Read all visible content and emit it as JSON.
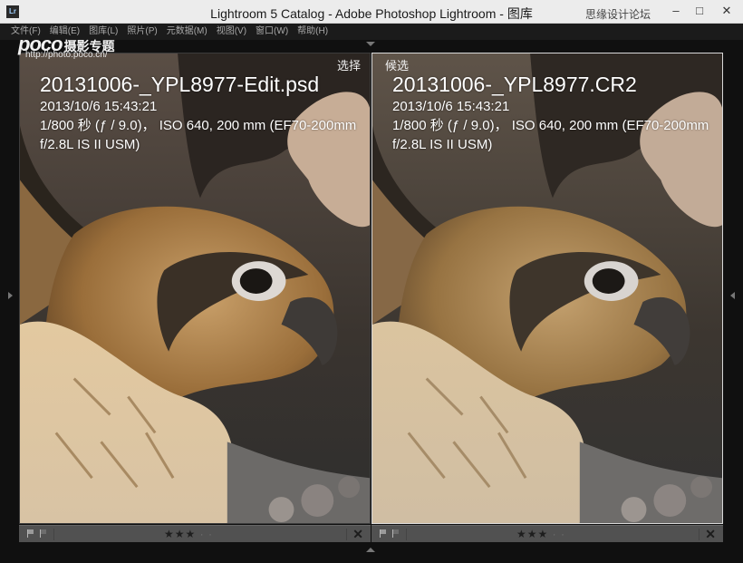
{
  "window": {
    "app_icon": "Lr",
    "title": "Lightroom 5 Catalog - Adobe Photoshop Lightroom - 图库",
    "watermark_site": "思缘设计论坛",
    "minimize": "–",
    "maximize": "□",
    "close": "✕"
  },
  "menu": {
    "items": [
      "文件(F)",
      "编辑(E)",
      "图库(L)",
      "照片(P)",
      "元数据(M)",
      "视图(V)",
      "窗口(W)",
      "帮助(H)"
    ]
  },
  "watermark": {
    "logo": "poco",
    "subtitle": "摄影专题",
    "url": "http://photo.poco.cn/"
  },
  "left_panel": {
    "label": "选择",
    "filename": "20131006-_YPL8977-Edit.psd",
    "datetime": "2013/10/6 15:43:21",
    "exif": "1/800 秒 (ƒ / 9.0)， ISO 640, 200 mm (EF70-200mm f/2.8L IS II USM)",
    "rating": "★★★",
    "rating_value": 3,
    "rating_placeholders": "· ·",
    "close": "✕"
  },
  "right_panel": {
    "label": "候选",
    "filename": "20131006-_YPL8977.CR2",
    "datetime": "2013/10/6 15:43:21",
    "exif": "1/800 秒 (ƒ / 9.0)， ISO 640, 200 mm (EF70-200mm f/2.8L IS II USM)",
    "rating": "★★★",
    "rating_value": 3,
    "rating_placeholders": "· ·",
    "close": "✕"
  },
  "colors": {
    "background": "#101010",
    "toolbar": "#515151",
    "titlebar": "#ececec",
    "menubar": "#1b1b1b",
    "selected_border": "#d8d8d8"
  }
}
